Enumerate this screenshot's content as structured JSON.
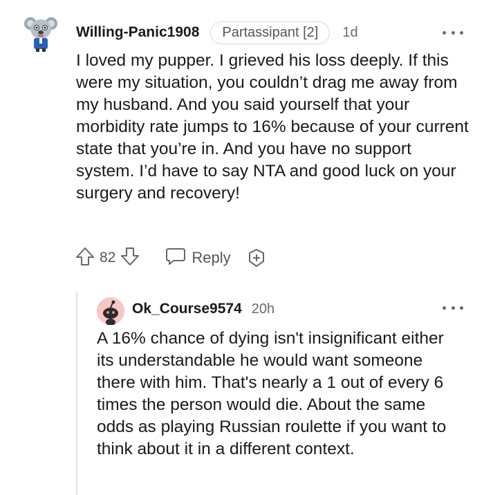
{
  "comments": [
    {
      "username": "Willing-Panic1908",
      "flair": "Partassipant [2]",
      "time": "1d",
      "body": "I loved my pupper. I grieved his loss deeply. If this were my situation, you couldn’t drag me away from my husband. And you said yourself that your morbidity rate jumps to 16% because of your current state that you’re in. And you have no support system. I’d have to say NTA and good luck on your surgery and recovery!",
      "votes": "82",
      "reply_label": "Reply",
      "icons": {
        "avatar": "koala-avatar-icon",
        "upvote": "upvote-arrow-icon",
        "downvote": "downvote-arrow-icon",
        "reply": "speech-bubble-icon",
        "award": "award-plus-icon",
        "more": "more-options-icon"
      }
    },
    {
      "username": "Ok_Course9574",
      "time": "20h",
      "body": "A 16% chance of dying isn't insignificant either its understandable he would want someone there with him. That's nearly a 1 out of every 6 times the person would die. About the same odds as playing Russian roulette if you want to think about it in a different context.",
      "icons": {
        "avatar": "snoo-avatar-icon",
        "more": "more-options-icon"
      }
    }
  ],
  "colors": {
    "text": "#1a1a1b",
    "muted": "#6a6a6a",
    "avatar_bg_reply": "#f7c6c6",
    "thread_line": "#e3e3e3"
  }
}
